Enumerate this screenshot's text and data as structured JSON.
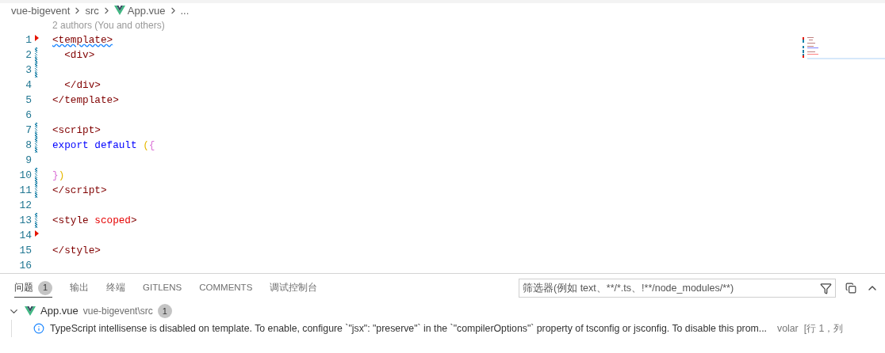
{
  "breadcrumb": [
    "vue-bigevent",
    "src",
    "App.vue",
    "..."
  ],
  "blame": "2 authors (You and others)",
  "lines": [
    {
      "number": "1",
      "modified": false,
      "deleted": true,
      "warning": true,
      "tokens": [
        {
          "kind": "tag",
          "text": "<template>"
        }
      ]
    },
    {
      "number": "2",
      "modified": true,
      "deleted": false,
      "indented": true,
      "tokens": [
        {
          "kind": "tag",
          "text": "<div>"
        }
      ]
    },
    {
      "number": "3",
      "modified": true,
      "deleted": false
    },
    {
      "number": "4",
      "modified": false,
      "deleted": false,
      "indented": true,
      "tokens": [
        {
          "kind": "tag",
          "text": "</div>"
        }
      ]
    },
    {
      "number": "5",
      "modified": false,
      "deleted": false,
      "tokens": [
        {
          "kind": "tag",
          "text": "</template>"
        }
      ]
    },
    {
      "number": "6",
      "modified": false,
      "deleted": false
    },
    {
      "number": "7",
      "modified": true,
      "deleted": false,
      "tokens": [
        {
          "kind": "tag",
          "text": "<script>"
        }
      ]
    },
    {
      "number": "8",
      "modified": true,
      "deleted": false,
      "tokens": [
        {
          "kind": "keyword",
          "text": "export default"
        },
        {
          "kind": "bracket1",
          "text": "(",
          "spaced": true
        },
        {
          "kind": "bracket2",
          "text": "{"
        }
      ]
    },
    {
      "number": "9",
      "modified": false,
      "deleted": false
    },
    {
      "number": "10",
      "modified": true,
      "deleted": false,
      "tokens": [
        {
          "kind": "bracket2",
          "text": "}"
        },
        {
          "kind": "bracket1",
          "text": ")"
        }
      ]
    },
    {
      "number": "11",
      "modified": true,
      "deleted": false,
      "tokens": [
        {
          "kind": "tag",
          "text": "</script>"
        }
      ]
    },
    {
      "number": "12",
      "modified": false,
      "deleted": false
    },
    {
      "number": "13",
      "modified": true,
      "deleted": false,
      "tokens": [
        {
          "kind": "tag",
          "text": "<style"
        },
        {
          "kind": "attr",
          "text": "scoped",
          "spaced": true
        },
        {
          "kind": "tag",
          "text": ">"
        }
      ]
    },
    {
      "number": "14",
      "modified": false,
      "deleted": true
    },
    {
      "number": "15",
      "modified": false,
      "deleted": false,
      "tokens": [
        {
          "kind": "tag",
          "text": "</style>"
        }
      ]
    },
    {
      "number": "16",
      "modified": false,
      "deleted": false
    }
  ],
  "panel": {
    "tabs": [
      {
        "label": "问题",
        "badge": "1",
        "selected": true
      },
      {
        "label": "输出",
        "selected": false
      },
      {
        "label": "终端",
        "selected": false
      },
      {
        "label": "GITLENS",
        "selected": false
      },
      {
        "label": "COMMENTS",
        "selected": false
      },
      {
        "label": "调试控制台",
        "selected": false
      }
    ],
    "filter": {
      "placeholder": "筛选器(例如 text、**/*.ts、!**/node_modules/**)"
    },
    "file": {
      "name": "App.vue",
      "path": "vue-bigevent\\src",
      "count": "1",
      "expanded": true
    },
    "problems": [
      {
        "kind": "info",
        "message": "TypeScript intellisense is disabled on template. To enable, configure `\"jsx\": \"preserve\"` in the `\"compilerOptions\"` property of tsconfig or jsconfig. To disable this prom...",
        "source": "volar",
        "location": "[行 1，列"
      }
    ]
  }
}
